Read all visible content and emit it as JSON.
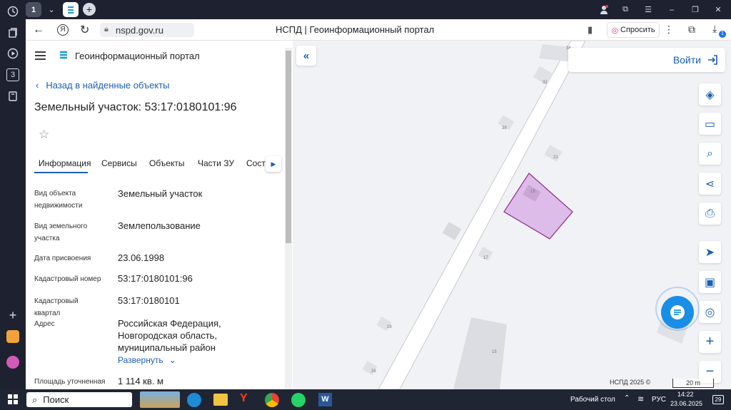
{
  "browser": {
    "tab_count": "1",
    "url": "nspd.gov.ru",
    "page_title": "НСПД | Геоинформационный портал",
    "ask_label": "Спросить",
    "left_badge": "3",
    "download_badge": "1"
  },
  "panel": {
    "portal_title": "Геоинформационный портал",
    "back_link": "Назад в найденные объекты",
    "heading": "Земельный участок: 53:17:0180101:96",
    "tabs": [
      "Информация",
      "Сервисы",
      "Объекты",
      "Части ЗУ",
      "Соста"
    ],
    "fields": [
      {
        "label": "Вид объекта недвижимости",
        "value": "Земельный участок"
      },
      {
        "label": "Вид земельного участка",
        "value": "Землепользование"
      },
      {
        "label": "Дата присвоения",
        "value": "23.06.1998"
      },
      {
        "label": "Кадастровый номер",
        "value": "53:17:0180101:96"
      },
      {
        "label": "Кадастровый квартал",
        "value": "53:17:0180101"
      },
      {
        "label": "Адрес",
        "value": "Российская Федерация, Новгородская область, муниципальный район"
      },
      {
        "label": "Площадь уточненная",
        "value": "1 114 кв. м"
      }
    ],
    "expand_label": "Развернуть"
  },
  "map": {
    "login_label": "Войти",
    "attribution": "НСПД 2025 ©",
    "scale_label": "20 m",
    "house_numbers": [
      "34",
      "32",
      "38",
      "21",
      "19",
      "17",
      "28",
      "15",
      "26"
    ],
    "plot_color": "#d9b3e6",
    "plot_stroke": "#8e2a8a"
  },
  "taskbar": {
    "search_label": "Поиск",
    "desktop_label": "Рабочий стол",
    "lang": "РУС",
    "time": "14:22",
    "date": "23.06.2025",
    "notif_count": "29"
  }
}
